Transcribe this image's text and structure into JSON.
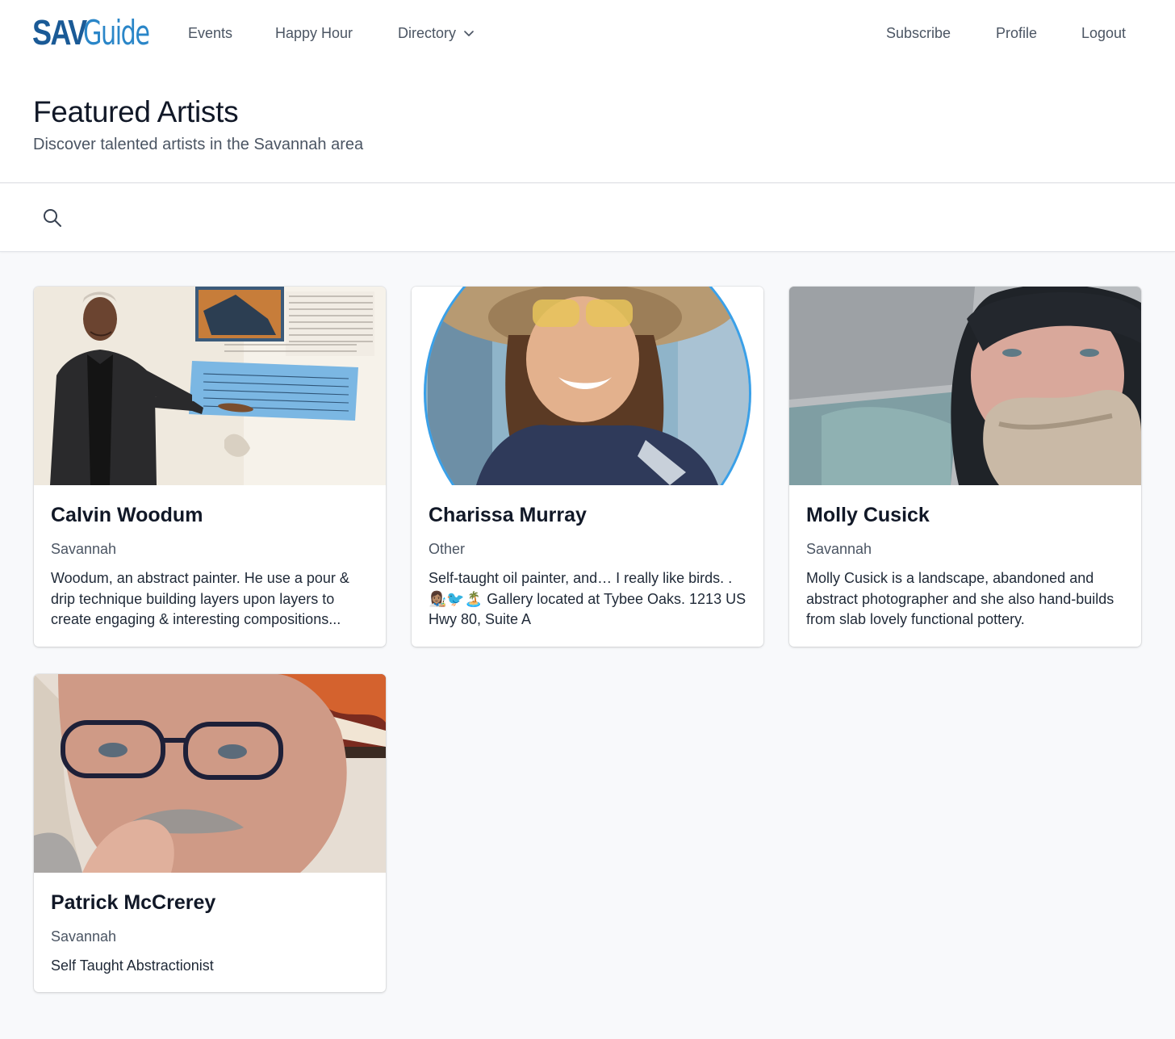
{
  "nav": {
    "logo_primary": "SAV",
    "logo_secondary": "Guide",
    "links": [
      "Events",
      "Happy Hour",
      "Directory"
    ],
    "right_links": [
      "Subscribe",
      "Profile",
      "Logout"
    ],
    "icons": {
      "directory_toggle": "chevron-down-icon"
    }
  },
  "header": {
    "title": "Featured Artists",
    "subtitle": "Discover talented artists in the Savannah area"
  },
  "search": {
    "icon": "search-icon",
    "placeholder": "",
    "value": ""
  },
  "artists": [
    {
      "name": "Calvin Woodum",
      "location": "Savannah",
      "bio": "Woodum, an abstract painter. He use a pour & drip technique building layers upon layers to create engaging & interesting compositions..."
    },
    {
      "name": "Charissa Murray",
      "location": "Other",
      "bio": "Self-taught oil painter, and… I really like birds. . 👩🏽‍🎨🐦🏝️ Gallery located at Tybee Oaks. 1213 US Hwy 80, Suite A"
    },
    {
      "name": "Molly Cusick",
      "location": "Savannah",
      "bio": "Molly Cusick is a landscape, abandoned and abstract photographer and she also hand-builds from slab lovely functional pottery."
    },
    {
      "name": "Patrick McCrerey",
      "location": "Savannah",
      "bio": "Self Taught Abstractionist"
    }
  ],
  "colors": {
    "brand_dark": "#1a5a96",
    "brand_light": "#2a86c8",
    "page_bg": "#f8f9fb",
    "accent_ring": "#3aa0e8"
  }
}
